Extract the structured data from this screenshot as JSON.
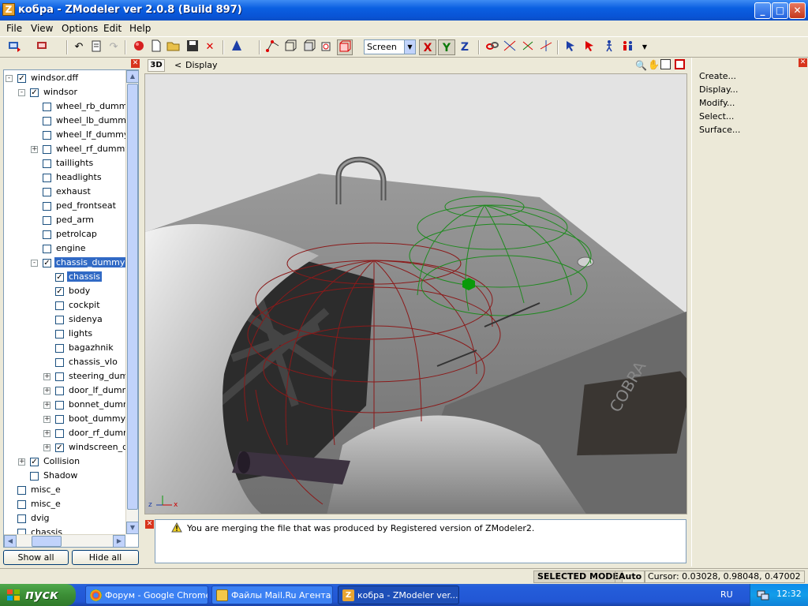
{
  "window": {
    "title": "кобра - ZModeler ver 2.0.8 (Build 897)",
    "app_icon_letter": "Z",
    "minimize": "_",
    "maximize": "□",
    "close": "✕"
  },
  "menu": [
    "File",
    "View",
    "Options",
    "Edit",
    "Help"
  ],
  "toolbar": {
    "view_mode": "Screen",
    "axis_x": "X",
    "axis_y": "Y",
    "axis_z": "Z"
  },
  "tree": {
    "items": [
      {
        "label": "windsor.dff",
        "checked": true,
        "expander": "-"
      },
      {
        "label": "windsor",
        "checked": true,
        "expander": "-"
      },
      {
        "label": "wheel_rb_dummy",
        "checked": false,
        "expander": ""
      },
      {
        "label": "wheel_lb_dummy",
        "checked": false,
        "expander": ""
      },
      {
        "label": "wheel_lf_dummy",
        "checked": false,
        "expander": ""
      },
      {
        "label": "wheel_rf_dummy",
        "checked": false,
        "expander": "+"
      },
      {
        "label": "taillights",
        "checked": false,
        "expander": ""
      },
      {
        "label": "headlights",
        "checked": false,
        "expander": ""
      },
      {
        "label": "exhaust",
        "checked": false,
        "expander": ""
      },
      {
        "label": "ped_frontseat",
        "checked": false,
        "expander": ""
      },
      {
        "label": "ped_arm",
        "checked": false,
        "expander": ""
      },
      {
        "label": "petrolcap",
        "checked": false,
        "expander": ""
      },
      {
        "label": "engine",
        "checked": false,
        "expander": ""
      },
      {
        "label": "chassis_dummy",
        "checked": true,
        "expander": "-"
      },
      {
        "label": "chassis",
        "checked": true,
        "expander": ""
      },
      {
        "label": "body",
        "checked": true,
        "expander": ""
      },
      {
        "label": "cockpit",
        "checked": false,
        "expander": ""
      },
      {
        "label": "sidenya",
        "checked": false,
        "expander": ""
      },
      {
        "label": "lights",
        "checked": false,
        "expander": ""
      },
      {
        "label": "bagazhnik",
        "checked": false,
        "expander": ""
      },
      {
        "label": "chassis_vlo",
        "checked": false,
        "expander": ""
      },
      {
        "label": "steering_dumm",
        "checked": false,
        "expander": "+"
      },
      {
        "label": "door_lf_dummy",
        "checked": false,
        "expander": "+"
      },
      {
        "label": "bonnet_dummy",
        "checked": false,
        "expander": "+"
      },
      {
        "label": "boot_dummy",
        "checked": false,
        "expander": "+"
      },
      {
        "label": "door_rf_dummy",
        "checked": false,
        "expander": "+"
      },
      {
        "label": "windscreen_du",
        "checked": true,
        "expander": "+"
      },
      {
        "label": "Collision",
        "checked": true,
        "expander": "+"
      },
      {
        "label": "Shadow",
        "checked": false,
        "expander": ""
      },
      {
        "label": "misc_e",
        "checked": false,
        "expander": ""
      },
      {
        "label": "misc_e",
        "checked": false,
        "expander": ""
      },
      {
        "label": "dvig",
        "checked": false,
        "expander": ""
      },
      {
        "label": "chassis",
        "checked": false,
        "expander": ""
      }
    ],
    "show_all": "Show all",
    "hide_all": "Hide all"
  },
  "viewport": {
    "mode_label": "3D",
    "nav_label": "<",
    "display_label": "Display",
    "axis_z": "z",
    "axis_x": "x"
  },
  "log": {
    "message": "You are merging the file that was produced by Registered version of ZModeler2."
  },
  "commands": [
    "Create...",
    "Display...",
    "Modify...",
    "Select...",
    "Surface..."
  ],
  "status": {
    "mode": "SELECTED MODE",
    "auto": "Auto",
    "cursor": "Cursor: 0.03028, 0.98048, 0.47002"
  },
  "taskbar": {
    "start": "пуск",
    "tasks": [
      {
        "label": "Форум - Google Chrome",
        "active": false
      },
      {
        "label": "Файлы Mail.Ru Агента",
        "active": false
      },
      {
        "label": "кобра - ZModeler ver...",
        "active": true
      }
    ],
    "lang": "RU",
    "clock": "12:32"
  },
  "colors": {
    "selection": "#316ac5",
    "wire_red": "#8b1a1a",
    "wire_green": "#1e8a1e"
  }
}
